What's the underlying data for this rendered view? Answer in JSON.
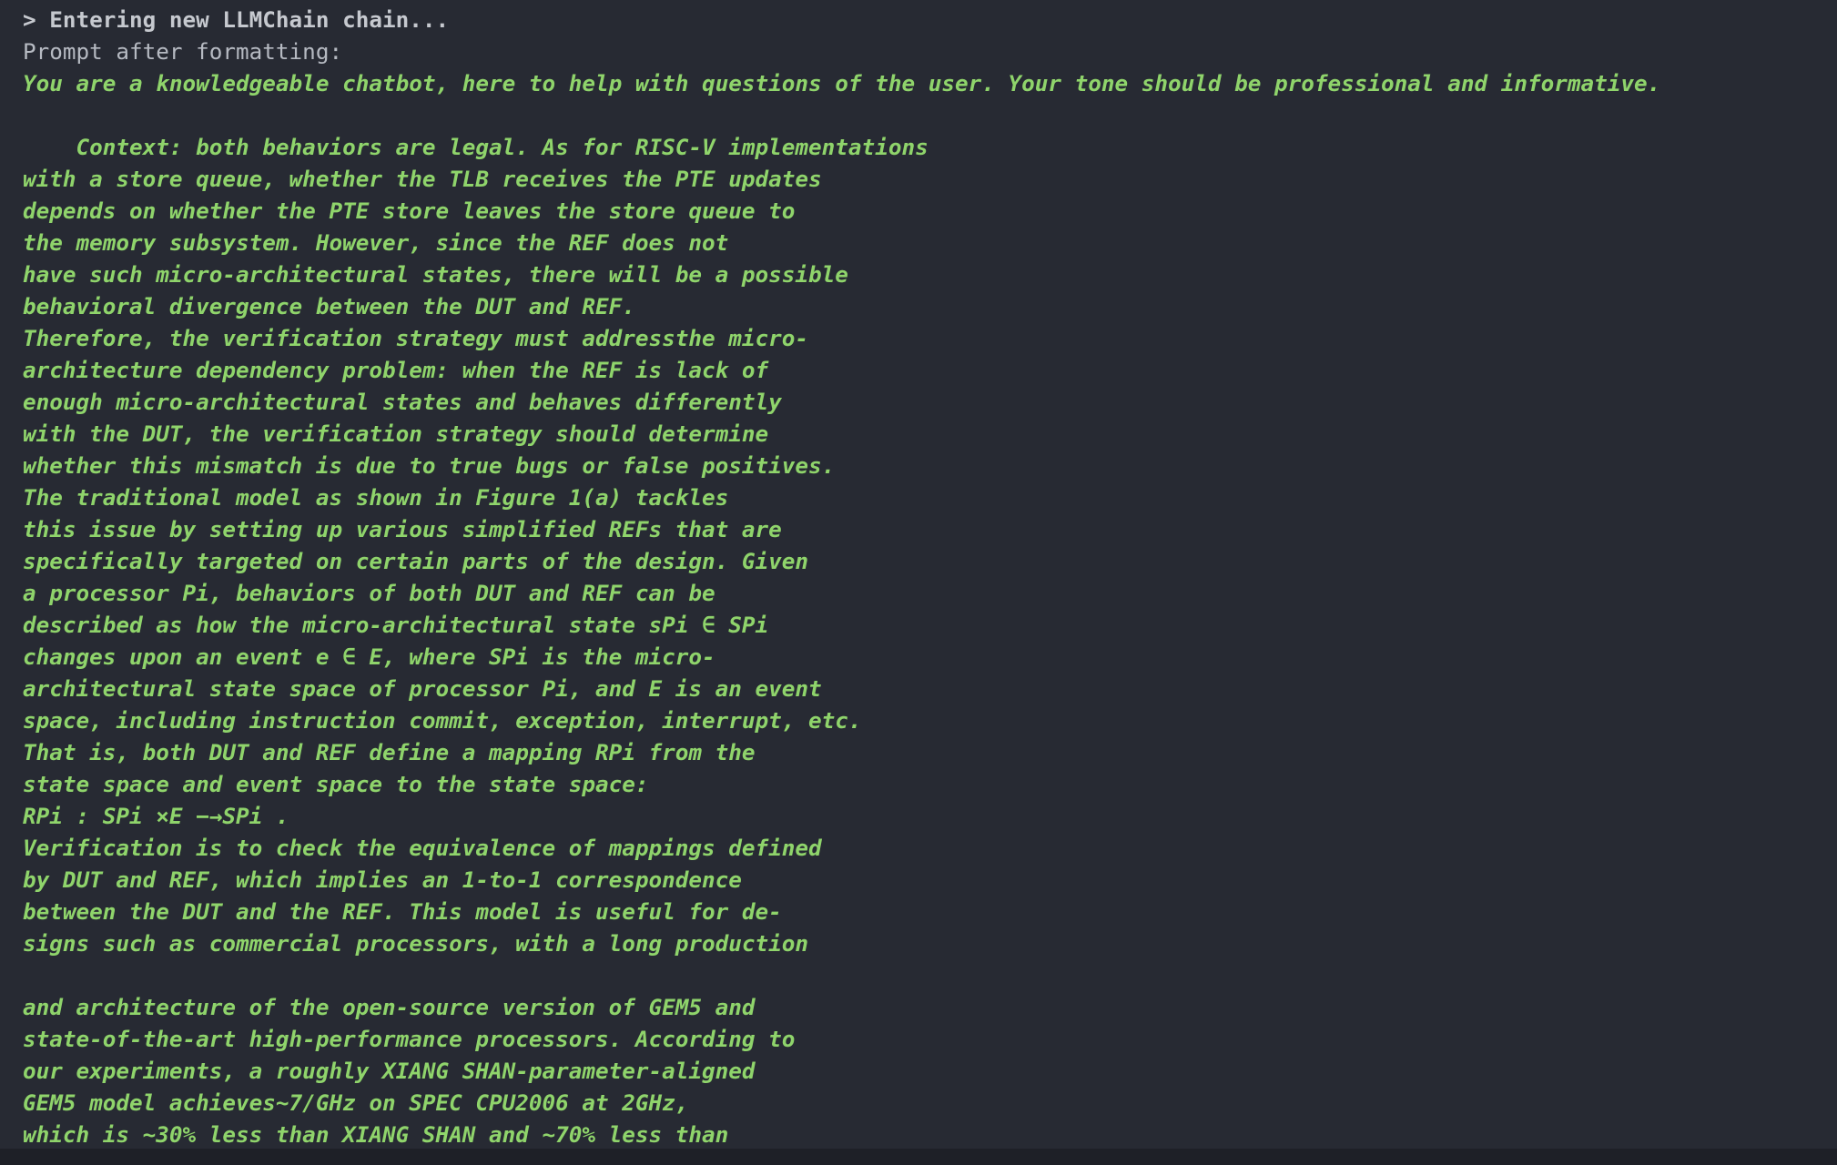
{
  "output": {
    "header": "> Entering new LLMChain chain...",
    "prompt_label": "Prompt after formatting:",
    "prompt_lines": [
      "You are a knowledgeable chatbot, here to help with questions of the user. Your tone should be professional and informative.",
      "",
      "    Context: both behaviors are legal. As for RISC-V implementations",
      "with a store queue, whether the TLB receives the PTE updates",
      "depends on whether the PTE store leaves the store queue to",
      "the memory subsystem. However, since the REF does not",
      "have such micro-architectural states, there will be a possible",
      "behavioral divergence between the DUT and REF.",
      "Therefore, the verification strategy must addressthe micro-",
      "architecture dependency problem: when the REF is lack of",
      "enough micro-architectural states and behaves differently",
      "with the DUT, the verification strategy should determine",
      "whether this mismatch is due to true bugs or false positives.",
      "The traditional model as shown in Figure 1(a) tackles",
      "this issue by setting up various simplified REFs that are",
      "specifically targeted on certain parts of the design. Given",
      "a processor Pi, behaviors of both DUT and REF can be",
      "described as how the micro-architectural state sPi ∈ SPi",
      "changes upon an event e ∈ E, where SPi is the micro-",
      "architectural state space of processor Pi, and E is an event",
      "space, including instruction commit, exception, interrupt, etc.",
      "That is, both DUT and REF define a mapping RPi from the",
      "state space and event space to the state space:",
      "RPi : SPi ×E −→SPi .",
      "Verification is to check the equivalence of mappings defined",
      "by DUT and REF, which implies an 1-to-1 correspondence",
      "between the DUT and the REF. This model is useful for de-",
      "signs such as commercial processors, with a long production",
      "",
      "and architecture of the open-source version of GEM5 and",
      "state-of-the-art high-performance processors. According to",
      "our experiments, a roughly XIANG SHAN-parameter-aligned",
      "GEM5 model achieves~7/GHz on SPEC CPU2006 at 2GHz,",
      "which is ~30% less than XIANG SHAN and ~70% less than"
    ]
  },
  "colors": {
    "background": "#272a33",
    "header_text": "#c6c9cf",
    "prompt_text": "#8fd46b"
  }
}
